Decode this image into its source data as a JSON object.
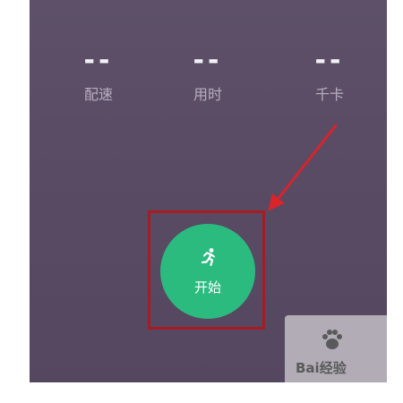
{
  "stats": [
    {
      "value": "--",
      "label": "配速"
    },
    {
      "value": "--",
      "label": "用时"
    },
    {
      "value": "--",
      "label": "千卡"
    }
  ],
  "start_button": {
    "label": "开始",
    "icon": "runner-icon"
  },
  "watermark": {
    "text": "Bai经验"
  },
  "colors": {
    "background": "#5a4c64",
    "accent": "#2cbb7f",
    "annotation": "#d8242a"
  }
}
